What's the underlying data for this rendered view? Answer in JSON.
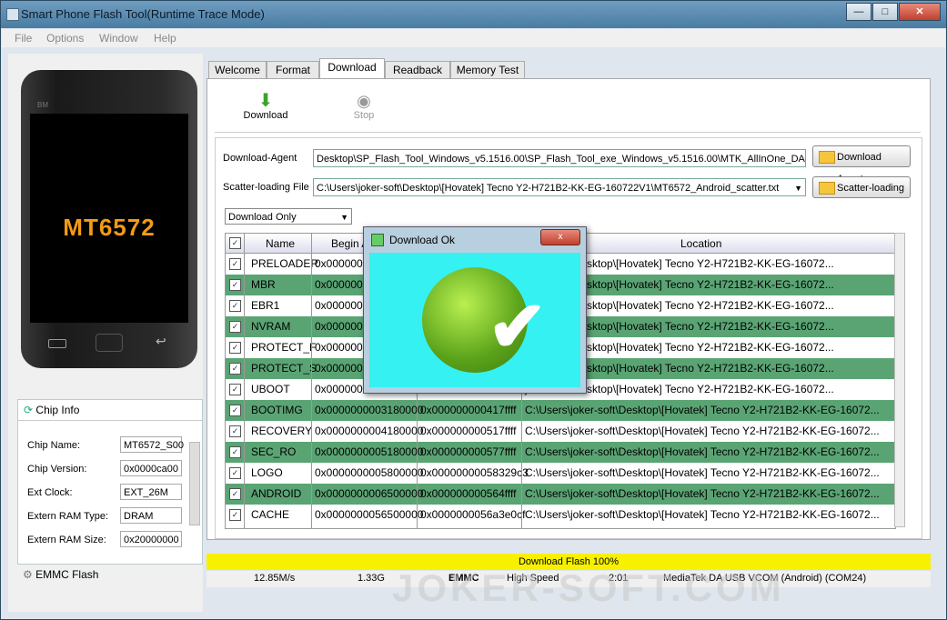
{
  "window": {
    "title": "Smart Phone Flash Tool(Runtime Trace Mode)"
  },
  "menu": [
    "File",
    "Options",
    "Window",
    "Help"
  ],
  "phone": {
    "model": "MT6572",
    "brand": "BM"
  },
  "chip_info": {
    "header": "Chip Info",
    "rows": [
      {
        "label": "Chip Name:",
        "value": "MT6572_S00"
      },
      {
        "label": "Chip Version:",
        "value": "0x0000ca00"
      },
      {
        "label": "Ext Clock:",
        "value": "EXT_26M"
      },
      {
        "label": "Extern RAM Type:",
        "value": "DRAM"
      },
      {
        "label": "Extern RAM Size:",
        "value": "0x20000000"
      }
    ],
    "emmc": "EMMC Flash"
  },
  "tabs": [
    "Welcome",
    "Format",
    "Download",
    "Readback",
    "Memory Test"
  ],
  "active_tab": "Download",
  "toolbar": {
    "download": "Download",
    "stop": "Stop"
  },
  "agent": {
    "label": "Download-Agent",
    "path": "Desktop\\SP_Flash_Tool_Windows_v5.1516.00\\SP_Flash_Tool_exe_Windows_v5.1516.00\\MTK_AllInOne_DA.bin",
    "button": "Download Agent"
  },
  "scatter": {
    "label": "Scatter-loading File",
    "path": "C:\\Users\\joker-soft\\Desktop\\[Hovatek] Tecno Y2-H721B2-KK-EG-160722V1\\MT6572_Android_scatter.txt",
    "button": "Scatter-loading"
  },
  "mode": "Download Only",
  "table": {
    "headers": [
      "Name",
      "Begin A",
      "",
      "Location"
    ],
    "rows": [
      {
        "name": "PRELOADER",
        "begin": "0x0000000",
        "end": "",
        "loc": "joker-soft\\Desktop\\[Hovatek] Tecno Y2-H721B2-KK-EG-16072..."
      },
      {
        "name": "MBR",
        "begin": "0x0000000",
        "end": "",
        "loc": "joker-soft\\Desktop\\[Hovatek] Tecno Y2-H721B2-KK-EG-16072..."
      },
      {
        "name": "EBR1",
        "begin": "0x0000000",
        "end": "",
        "loc": "joker-soft\\Desktop\\[Hovatek] Tecno Y2-H721B2-KK-EG-16072..."
      },
      {
        "name": "NVRAM",
        "begin": "0x0000000",
        "end": "",
        "loc": "joker-soft\\Desktop\\[Hovatek] Tecno Y2-H721B2-KK-EG-16072..."
      },
      {
        "name": "PROTECT_F",
        "begin": "0x0000000",
        "end": "",
        "loc": "joker-soft\\Desktop\\[Hovatek] Tecno Y2-H721B2-KK-EG-16072..."
      },
      {
        "name": "PROTECT_S",
        "begin": "0x0000000",
        "end": "",
        "loc": "joker-soft\\Desktop\\[Hovatek] Tecno Y2-H721B2-KK-EG-16072..."
      },
      {
        "name": "UBOOT",
        "begin": "0x0000000",
        "end": "",
        "loc": "joker-soft\\Desktop\\[Hovatek] Tecno Y2-H721B2-KK-EG-16072..."
      },
      {
        "name": "BOOTIMG",
        "begin": "0x0000000003180000",
        "end": "0x000000000417ffff",
        "loc": "C:\\Users\\joker-soft\\Desktop\\[Hovatek] Tecno Y2-H721B2-KK-EG-16072..."
      },
      {
        "name": "RECOVERY",
        "begin": "0x0000000004180000",
        "end": "0x000000000517ffff",
        "loc": "C:\\Users\\joker-soft\\Desktop\\[Hovatek] Tecno Y2-H721B2-KK-EG-16072..."
      },
      {
        "name": "SEC_RO",
        "begin": "0x0000000005180000",
        "end": "0x000000000577ffff",
        "loc": "C:\\Users\\joker-soft\\Desktop\\[Hovatek] Tecno Y2-H721B2-KK-EG-16072..."
      },
      {
        "name": "LOGO",
        "begin": "0x0000000005800000",
        "end": "0x00000000058329c3",
        "loc": "C:\\Users\\joker-soft\\Desktop\\[Hovatek] Tecno Y2-H721B2-KK-EG-16072..."
      },
      {
        "name": "ANDROID",
        "begin": "0x0000000006500000",
        "end": "0x000000000564ffff",
        "loc": "C:\\Users\\joker-soft\\Desktop\\[Hovatek] Tecno Y2-H721B2-KK-EG-16072..."
      },
      {
        "name": "CACHE",
        "begin": "0x0000000056500000",
        "end": "0x0000000056a3e0cf",
        "loc": "C:\\Users\\joker-soft\\Desktop\\[Hovatek] Tecno Y2-H721B2-KK-EG-16072..."
      }
    ]
  },
  "progress": {
    "label": "Download Flash 100%",
    "value": 100
  },
  "status": {
    "speed": "12.85M/s",
    "size": "1.33G",
    "storage": "EMMC",
    "mode": "High Speed",
    "time": "2:01",
    "port": "MediaTek DA USB VCOM (Android) (COM24)"
  },
  "dialog": {
    "title": "Download Ok",
    "close": "x"
  },
  "watermark": "JOKER-SOFT.COM",
  "colors": {
    "row_alt": "#5aa474",
    "progress": "#f7f100",
    "dialog_bg": "#35f1f1",
    "accent": "#f39a16"
  }
}
